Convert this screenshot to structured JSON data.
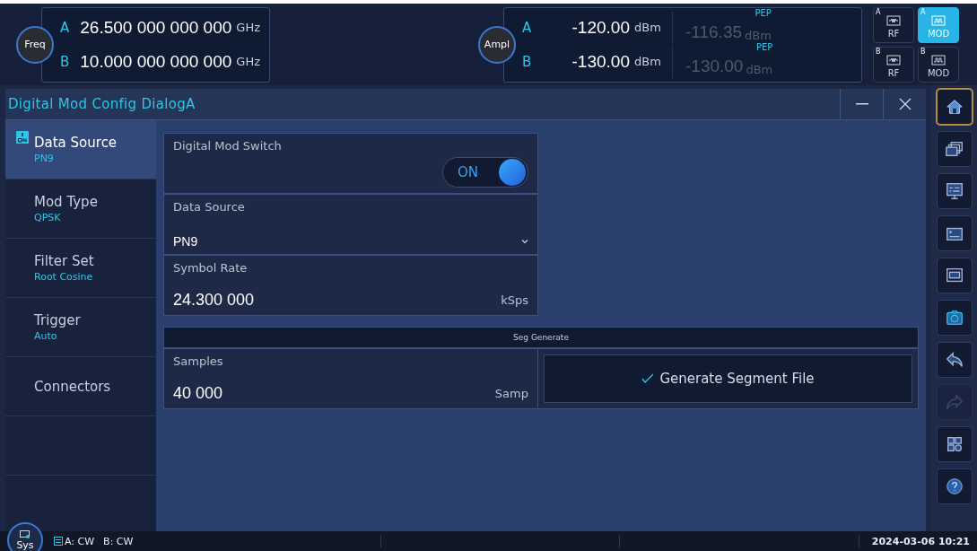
{
  "freq": {
    "label": "Freq",
    "rows": [
      {
        "channel": "A",
        "value": "26.500 000 000 000",
        "unit": "GHz"
      },
      {
        "channel": "B",
        "value": "10.000 000 000 000",
        "unit": "GHz"
      }
    ]
  },
  "ampl": {
    "label": "Ampl",
    "rows": [
      {
        "channel": "A",
        "value": "-120.00",
        "unit": "dBm",
        "pep_label": "PEP",
        "pep_value": "-116.35",
        "pep_unit": "dBm"
      },
      {
        "channel": "B",
        "value": "-130.00",
        "unit": "dBm",
        "pep_label": "PEP",
        "pep_value": "-130.00",
        "pep_unit": "dBm"
      }
    ]
  },
  "mode_buttons": [
    {
      "channel": "A",
      "label": "RF",
      "kind": "rf",
      "selected": false
    },
    {
      "channel": "A",
      "label": "MOD",
      "kind": "mod",
      "selected": true
    },
    {
      "channel": "B",
      "label": "RF",
      "kind": "rf",
      "selected": false
    },
    {
      "channel": "B",
      "label": "MOD",
      "kind": "mod",
      "selected": false
    }
  ],
  "dialog": {
    "title": "Digital Mod Config DialogA",
    "menu": [
      {
        "label": "Data Source",
        "value": "PN9",
        "selected": true
      },
      {
        "label": "Mod Type",
        "value": "QPSK",
        "selected": false
      },
      {
        "label": "Filter Set",
        "value": "Root Cosine",
        "selected": false
      },
      {
        "label": "Trigger",
        "value": "Auto",
        "selected": false
      },
      {
        "label": "Connectors",
        "selected": false
      }
    ],
    "switch": {
      "label": "Digital Mod Switch",
      "text": "ON",
      "on": true
    },
    "data_source": {
      "label": "Data Source",
      "value": "PN9"
    },
    "symbol_rate": {
      "label": "Symbol Rate",
      "value": "24.300 000",
      "unit": "kSps"
    },
    "section": "Seg Generate",
    "samples": {
      "label": "Samples",
      "value": "40 000",
      "unit": "Samp"
    },
    "generate_button": "Generate Segment File"
  },
  "toolbar": [
    {
      "kind": "home",
      "selected": true,
      "disabled": false
    },
    {
      "kind": "windows",
      "selected": false,
      "disabled": false
    },
    {
      "kind": "monitor",
      "selected": false,
      "disabled": false
    },
    {
      "kind": "scpi-terminal",
      "selected": false,
      "disabled": false
    },
    {
      "kind": "scpi-screen",
      "selected": false,
      "disabled": false
    },
    {
      "kind": "camera",
      "selected": false,
      "disabled": false
    },
    {
      "kind": "undo",
      "selected": false,
      "disabled": false
    },
    {
      "kind": "redo",
      "selected": false,
      "disabled": true
    },
    {
      "kind": "grid",
      "selected": false,
      "disabled": false
    },
    {
      "kind": "help",
      "selected": false,
      "disabled": false
    }
  ],
  "status_bar": {
    "sys_label": "Sys",
    "channel_a": "A: CW",
    "channel_b": "B: CW",
    "datetime": "2024-03-06 10:21"
  }
}
